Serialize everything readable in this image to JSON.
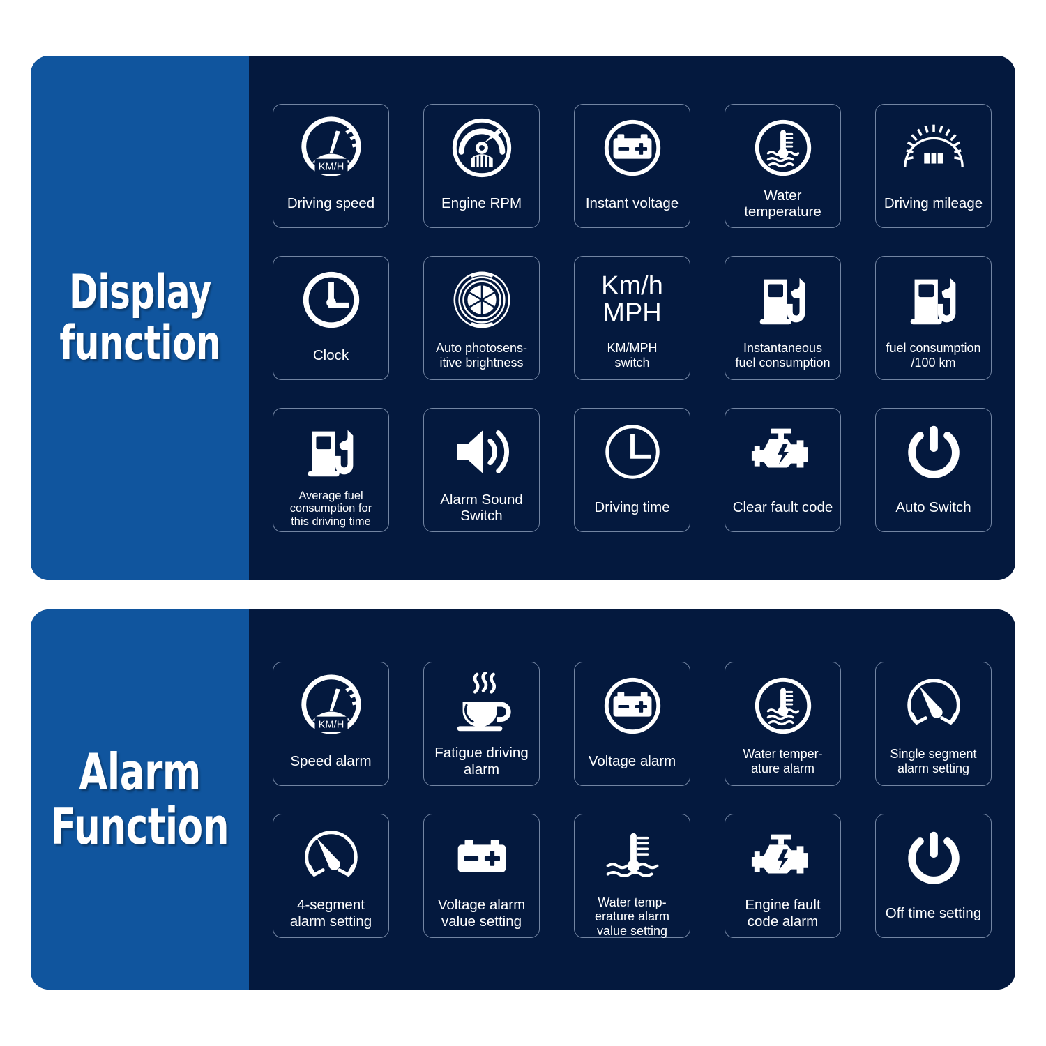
{
  "colors": {
    "sidebar_blue": "#10559E",
    "panel_navy": "#04193E",
    "page_background": "#FFFFFF",
    "card_border": "#BECDE6",
    "icon_white": "#FFFFFF"
  },
  "sections": [
    {
      "title": "Display\nfunction",
      "items": [
        {
          "label": "Driving speed",
          "icon": "speedometer-kmh-icon",
          "label_size": "normal"
        },
        {
          "label": "Engine RPM",
          "icon": "tachometer-rpm-icon",
          "label_size": "normal"
        },
        {
          "label": "Instant voltage",
          "icon": "battery-circle-icon",
          "label_size": "normal"
        },
        {
          "label": "Water\ntemperature",
          "icon": "water-temperature-circle-icon",
          "label_size": "normal"
        },
        {
          "label": "Driving mileage",
          "icon": "odometer-icon",
          "label_size": "normal"
        },
        {
          "label": "Clock",
          "icon": "clock-icon",
          "label_size": "normal"
        },
        {
          "label": "Auto photosens-\nitive brightness",
          "icon": "aperture-sensor-icon",
          "label_size": "small"
        },
        {
          "label": "KM/MPH\nswitch",
          "icon": "kmh-mph-text-icon",
          "label_size": "small",
          "icon_text": "Km/h\nMPH"
        },
        {
          "label": "Instantaneous\nfuel consumption",
          "icon": "fuel-pump-icon",
          "label_size": "small"
        },
        {
          "label": "fuel consumption\n/100 km",
          "icon": "fuel-pump-icon",
          "label_size": "small"
        },
        {
          "label": "Average fuel\nconsumption for\nthis driving time",
          "icon": "fuel-pump-icon",
          "label_size": "tiny"
        },
        {
          "label": "Alarm Sound\nSwitch",
          "icon": "speaker-volume-icon",
          "label_size": "normal"
        },
        {
          "label": "Driving time",
          "icon": "clock-hour-icon",
          "label_size": "normal"
        },
        {
          "label": "Clear fault code",
          "icon": "engine-fault-icon",
          "label_size": "normal"
        },
        {
          "label": "Auto Switch",
          "icon": "power-icon",
          "label_size": "normal"
        }
      ]
    },
    {
      "title": "Alarm\nFunction",
      "items": [
        {
          "label": "Speed alarm",
          "icon": "speedometer-kmh-icon",
          "label_size": "normal"
        },
        {
          "label": "Fatigue driving\nalarm",
          "icon": "coffee-cup-icon",
          "label_size": "normal"
        },
        {
          "label": "Voltage alarm",
          "icon": "battery-circle-icon",
          "label_size": "normal"
        },
        {
          "label": "Water temper-\nature alarm",
          "icon": "water-temperature-circle-icon",
          "label_size": "small"
        },
        {
          "label": "Single segment\nalarm setting",
          "icon": "gauge-needle-icon",
          "label_size": "small"
        },
        {
          "label": "4-segment\nalarm setting",
          "icon": "gauge-needle-icon",
          "label_size": "normal"
        },
        {
          "label": "Voltage alarm\nvalue setting",
          "icon": "battery-icon",
          "label_size": "normal"
        },
        {
          "label": "Water temp-\nerature alarm\nvalue setting",
          "icon": "thermometer-water-icon",
          "label_size": "small"
        },
        {
          "label": "Engine fault\ncode alarm",
          "icon": "engine-fault-icon",
          "label_size": "normal"
        },
        {
          "label": "Off time setting",
          "icon": "power-icon",
          "label_size": "normal"
        }
      ]
    }
  ]
}
